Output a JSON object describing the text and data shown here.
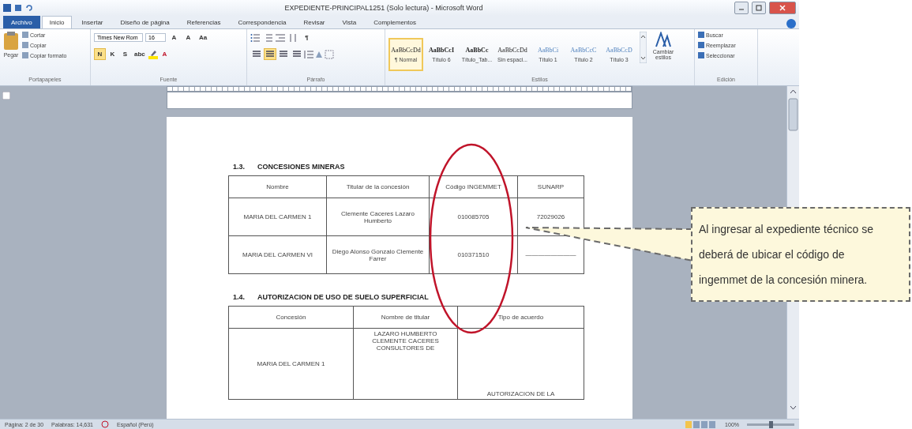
{
  "window": {
    "title": "EXPEDIENTE-PRINCIPAL1251 (Solo lectura) - Microsoft Word"
  },
  "tabs": [
    {
      "label": "Archivo",
      "kind": "file",
      "selected": false
    },
    {
      "label": "Inicio",
      "kind": "tab",
      "selected": true
    },
    {
      "label": "Insertar",
      "kind": "tab",
      "selected": false
    },
    {
      "label": "Diseño de página",
      "kind": "tab",
      "selected": false
    },
    {
      "label": "Referencias",
      "kind": "tab",
      "selected": false
    },
    {
      "label": "Correspondencia",
      "kind": "tab",
      "selected": false
    },
    {
      "label": "Revisar",
      "kind": "tab",
      "selected": false
    },
    {
      "label": "Vista",
      "kind": "tab",
      "selected": false
    },
    {
      "label": "Complementos",
      "kind": "tab",
      "selected": false
    }
  ],
  "ribbon": {
    "clipboard": {
      "paste": "Pegar",
      "items": [
        "Cortar",
        "Copiar",
        "Copiar formato"
      ],
      "label": "Portapapeles"
    },
    "font": {
      "font_name": "Times New Rom",
      "size": "16",
      "size_buttons": [
        "A",
        "A",
        "Aa"
      ],
      "format_buttons": [
        {
          "label": "N",
          "selected": true
        },
        {
          "label": "K",
          "selected": false
        },
        {
          "label": "S",
          "selected": false
        },
        {
          "label": "abc",
          "selected": false
        }
      ],
      "color_button": "A",
      "label": "Fuente"
    },
    "paragraph": {
      "pilcrow": "¶",
      "alignments": [
        {
          "selected": false
        },
        {
          "selected": true
        },
        {
          "selected": false
        },
        {
          "selected": false
        }
      ],
      "label": "Párrafo"
    },
    "styles": {
      "items": [
        {
          "preview": "AaBbCcDd",
          "name": "¶ Normal",
          "selected": true
        },
        {
          "preview": "AaBbCcI",
          "name": "Título 6",
          "selected": false
        },
        {
          "preview": "AaBbCc",
          "name": "Título_Tab...",
          "selected": false
        },
        {
          "preview": "AaBbCcDd",
          "name": "Sin espaci...",
          "selected": false
        },
        {
          "preview": "AaBbCi",
          "name": "Título 1",
          "selected": false
        },
        {
          "preview": "AaBbCcC",
          "name": "Título 2",
          "selected": false
        },
        {
          "preview": "AaBbCcD",
          "name": "Título 3",
          "selected": false
        }
      ],
      "change": "Cambiar estilos",
      "label": "Estilos"
    },
    "editing": {
      "items": [
        "Buscar",
        "Reemplazar",
        "Seleccionar"
      ],
      "label": "Edición"
    }
  },
  "document": {
    "sections": [
      {
        "number": "1.3.",
        "heading": "CONCESIONES MINERAS",
        "table": {
          "columns": [
            "Nombre",
            "Titular de la concesión",
            "Código INGEMMET",
            "SUNARP"
          ],
          "rows": [
            [
              "MARIA DEL CARMEN 1",
              "Clemente Caceres Lazaro Humberto",
              "010085705",
              "72029026"
            ],
            [
              "MARIA DEL CARMEN VI",
              "Diego Alonso Gonzalo Clemente Farrer",
              "010371510",
              "————————"
            ]
          ]
        }
      },
      {
        "number": "1.4.",
        "heading": "AUTORIZACION DE USO DE SUELO SUPERFICIAL",
        "table": {
          "columns": [
            "Concesión",
            "Nombre de titular",
            "Tipo de acuerdo"
          ],
          "rows": [
            [
              "MARIA DEL CARMEN 1",
              "LAZARO HUMBERTO CLEMENTE CACERES CONSULTORES DE",
              "AUTORIZACION DE LA"
            ]
          ]
        }
      }
    ]
  },
  "annotation": {
    "lines": [
      "Al ingresar al expediente técnico se",
      "deberá de ubicar el código de",
      "ingemmet de la concesión minera."
    ]
  },
  "status_bar": {
    "page": "Página: 2 de 30",
    "words": "Palabras: 14,631",
    "language": "Español (Perú)",
    "zoom": "100%",
    "zoom_level": {
      "level": 0.5
    }
  }
}
